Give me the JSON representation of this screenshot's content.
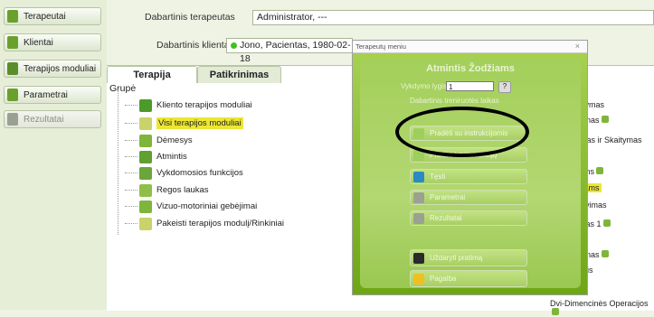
{
  "nav": [
    {
      "label": "Terapeutai",
      "color": "#6aa12d",
      "disabled": false
    },
    {
      "label": "Klientai",
      "color": "#6aa12d",
      "disabled": false
    },
    {
      "label": "Terapijos moduliai",
      "color": "#5a8e2a",
      "disabled": false
    },
    {
      "label": "Parametrai",
      "color": "#6aa12d",
      "disabled": false
    },
    {
      "label": "Rezultatai",
      "color": "#9aa191",
      "disabled": true
    }
  ],
  "header": {
    "therapist_label": "Dabartinis terapeutas",
    "therapist_value": "Administrator, ---",
    "client_label": "Dabartinis klientas",
    "client_value": "Jono, Pacientas, 1980-02-18"
  },
  "tabs": {
    "therapy": "Terapija",
    "experience": "Patikrinimas"
  },
  "group_label": "Grupė",
  "tree": [
    {
      "label": "Kliento terapijos moduliai",
      "color": "#4c9a2a",
      "highlight": false
    },
    {
      "label": "Visi terapijos moduliai",
      "color": "#c9d36a",
      "highlight": true
    },
    {
      "label": "Dėmesys",
      "color": "#7fb53a",
      "highlight": false
    },
    {
      "label": "Atmintis",
      "color": "#5fa030",
      "highlight": false
    },
    {
      "label": "Vykdomosios funkcijos",
      "color": "#6aa63a",
      "highlight": false
    },
    {
      "label": "Regos laukas",
      "color": "#8fbf4a",
      "highlight": false
    },
    {
      "label": "Vizuo-motoriniai gebėjimai",
      "color": "#7fb53a",
      "highlight": false
    },
    {
      "label": "Pakeisti terapijos modulį/Rinkiniai",
      "color": "#c9d36a",
      "highlight": false
    }
  ],
  "modal": {
    "window_title": "Terapeutų meniu",
    "close": "×",
    "title": "Atmintis Žodžiams",
    "level_label": "Vykdymo lygis",
    "level_value": "1",
    "help": "?",
    "info": "Dabartinis treniruotės laikas",
    "buttons": [
      {
        "label": "Pradėti su instrukcijomis",
        "icon": "#9ecf5c"
      },
      {
        "label": "Pradėti be instrukcijų",
        "icon": "#9ecf5c"
      },
      {
        "label": "Tęsti",
        "icon": "#2a8ac4"
      },
      {
        "label": "Parametrai",
        "icon": "#9aa191"
      },
      {
        "label": "Rezultatai",
        "icon": "#9aa191"
      }
    ],
    "bottom_buttons": [
      {
        "label": "Uždaryti pratimą",
        "icon": "#2a2a2a"
      },
      {
        "label": "Pagalba",
        "icon": "#f0c020"
      }
    ]
  },
  "right_items": [
    {
      "label": "statymas"
    },
    {
      "label": "vinimas"
    },
    {
      "label": "inimas ir Skaitymas"
    },
    {
      "label": "aroms"
    },
    {
      "label": "džiams",
      "highlight": true
    },
    {
      "label": "anavimas"
    },
    {
      "label": "rumas 1"
    },
    {
      "label": "vinimas"
    },
    {
      "label": "mintis"
    },
    {
      "label": "Dvi-Dimencinės Operacijos"
    }
  ]
}
